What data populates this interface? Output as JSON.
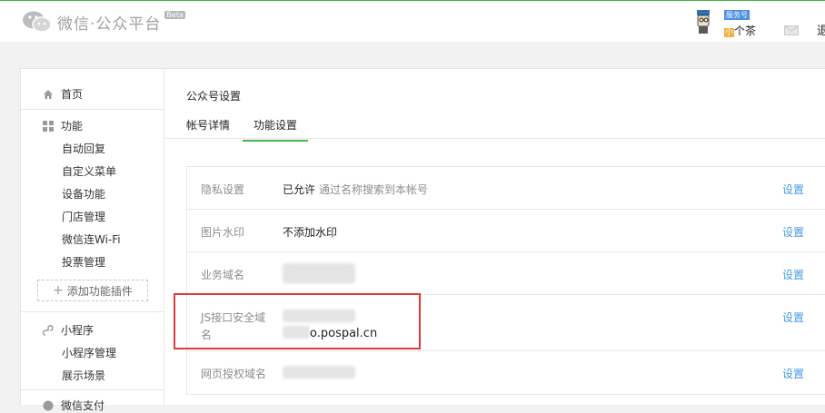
{
  "header": {
    "brand_text": "微信·公众平台",
    "beta_badge": "Beta",
    "account_type_badge": "服务号",
    "account_name_highlight": "小",
    "account_name_rest": "个茶",
    "logout_label": "退",
    "colors": {
      "accent": "#44b549",
      "link": "#459ae9",
      "alert": "#e0393c"
    }
  },
  "sidebar": {
    "home": "首页",
    "features": {
      "label": "功能",
      "items": [
        "自动回复",
        "自定义菜单",
        "设备功能",
        "门店管理",
        "微信连Wi-Fi",
        "投票管理"
      ]
    },
    "add_plugin": "添加功能插件",
    "mini_program": {
      "label": "小程序",
      "items": [
        "小程序管理",
        "展示场景"
      ]
    },
    "wechat_pay": "微信支付"
  },
  "main": {
    "title": "公众号设置",
    "tabs": [
      {
        "label": "帐号详情",
        "active": false
      },
      {
        "label": "功能设置",
        "active": true
      }
    ],
    "settings": [
      {
        "label": "隐私设置",
        "value": "已允许",
        "tip": "通过名称搜索到本帐号",
        "action": "设置"
      },
      {
        "label": "图片水印",
        "value": "不添加水印",
        "tip": "",
        "action": "设置"
      },
      {
        "label": "业务域名",
        "value": "",
        "tip": "",
        "action": "设置"
      },
      {
        "label_line1": "JS接口安全域",
        "label_line2": "名",
        "value": "o.pospal.cn",
        "tip": "",
        "action": "设置"
      },
      {
        "label": "网页授权域名",
        "value": "",
        "tip": "",
        "action": "设置"
      }
    ]
  }
}
